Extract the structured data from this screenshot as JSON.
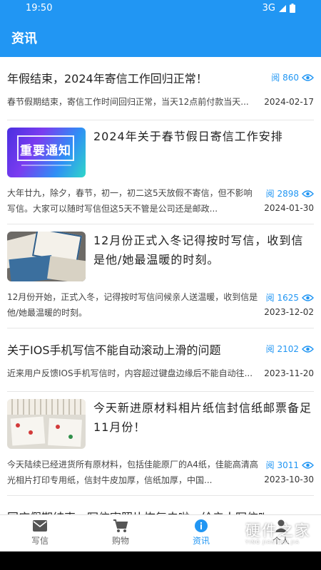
{
  "status": {
    "time": "19:50",
    "network": "3G"
  },
  "app": {
    "title": "资讯"
  },
  "news": [
    {
      "title": "年假结束，2024年寄信工作回归正常！",
      "summary": "春节假期结束，寄信工作时间回归正常，当天12点前付款当天...",
      "views": "阅 860",
      "date": "2024-02-17"
    },
    {
      "title": "2024年关于春节假日寄信工作安排",
      "image_text": "重要通知",
      "summary": "大年廿九，除夕，春节，初一，初二这5天放假不寄信，但不影响写信。大家可以随时写信但这5天不管是公司还是邮政...",
      "views": "阅 2898",
      "date": "2024-01-30"
    },
    {
      "title": "12月份正式入冬记得按时写信，收到信是他/她最温暖的时刻。",
      "summary": "12月份开始，正式入冬，记得按时写信问候亲人送温暖，收到信是他/她最温暖的时刻。",
      "views": "阅 1625",
      "date": "2023-12-02"
    },
    {
      "title": "关于IOS手机写信不能自动滚动上滑的问题",
      "summary": "近来用户反馈IOS手机写信时，内容超过键盘边缘后不能自动往...",
      "views": "阅 2102",
      "date": "2023-11-20"
    },
    {
      "title": "今天新进原材料相片纸信封信纸邮票备足11月份！",
      "summary": "今天陆续已经进货所有原材料，包括佳能原厂的A4纸，佳能高清高光相片打印专用纸，信封牛皮加厚，信纸加厚，中国...",
      "views": "阅 3011",
      "date": "2023-10-30"
    },
    {
      "title": "国庆假期结束，写信寄照片恢复去啦，给亲人写信吧"
    }
  ],
  "nav": [
    {
      "label": "写信",
      "icon": "mail-icon"
    },
    {
      "label": "购物",
      "icon": "cart-icon"
    },
    {
      "label": "资讯",
      "icon": "info-icon"
    },
    {
      "label": "个人",
      "icon": "person-icon"
    }
  ],
  "colors": {
    "primary": "#2196f3",
    "text": "#222222",
    "muted": "#666666"
  },
  "watermark": {
    "name": "硬件之家",
    "sub": "YING JIAN ZHI JIA"
  }
}
